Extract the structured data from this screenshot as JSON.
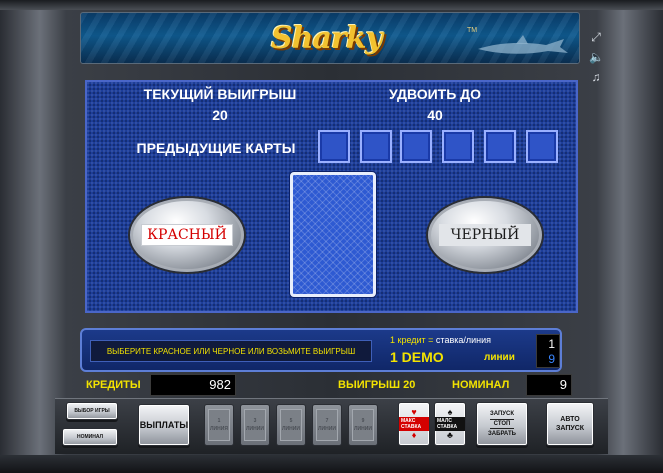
{
  "logo": {
    "text": "Sharky",
    "tm": "TM"
  },
  "side_icons": [
    {
      "name": "fullscreen",
      "glyph": "⤢"
    },
    {
      "name": "sound",
      "glyph": "🔈"
    },
    {
      "name": "music",
      "glyph": "♫"
    }
  ],
  "gamble": {
    "current_win_label": "ТЕКУЩИЙ ВЫИГРЫШ",
    "current_win_value": "20",
    "double_to_label": "УДВОИТЬ ДО",
    "double_to_value": "40",
    "previous_cards_label": "ПРЕДЫДУЩИЕ КАРТЫ",
    "previous_cards_count": 6,
    "red_label": "КРАСНЫЙ",
    "black_label": "ЧЕРНЫЙ"
  },
  "info": {
    "message": "ВЫБЕРИТЕ КРАСНОЕ ИЛИ ЧЕРНОЕ ИЛИ ВОЗЬМИТЕ ВЫИГРЫШ",
    "credit_rate_prefix": "1 кредит = ",
    "credit_rate_text": "ставка/линия",
    "demo": "1 DEMO",
    "lines_label": "линии",
    "rate_value": "1",
    "lines_value": "9"
  },
  "status": {
    "credits_label": "КРЕДИТЫ",
    "credits_value": "982",
    "win_label": "ВЫИГРЫШ 20",
    "denom_label": "НОМИНАЛ",
    "denom_value": "9"
  },
  "buttons": {
    "game_select": "ВЫБОР ИГРЫ",
    "denomination": "НОМИНАЛ",
    "payout": "ВЫПЛАТЫ",
    "lines": [
      {
        "num": "1",
        "word": "ЛИНИЯ"
      },
      {
        "num": "3",
        "word": "ЛИНИИ"
      },
      {
        "num": "5",
        "word": "ЛИНИИ"
      },
      {
        "num": "7",
        "word": "ЛИНИИ"
      },
      {
        "num": "9",
        "word": "ЛИНИИ"
      }
    ],
    "max_bet": "МАКС СТАВКА",
    "min_bet": "МАЛС СТАВКА",
    "start": "ЗАПУСК",
    "stop": "СТОП",
    "take": "ЗАБРАТЬ",
    "auto_start": "АВТО ЗАПУСК"
  },
  "colors": {
    "field_blue": "#1c3d9a",
    "yellow_text": "#f3e300",
    "red_text": "#d40000",
    "black_text": "#1a1a1a"
  }
}
